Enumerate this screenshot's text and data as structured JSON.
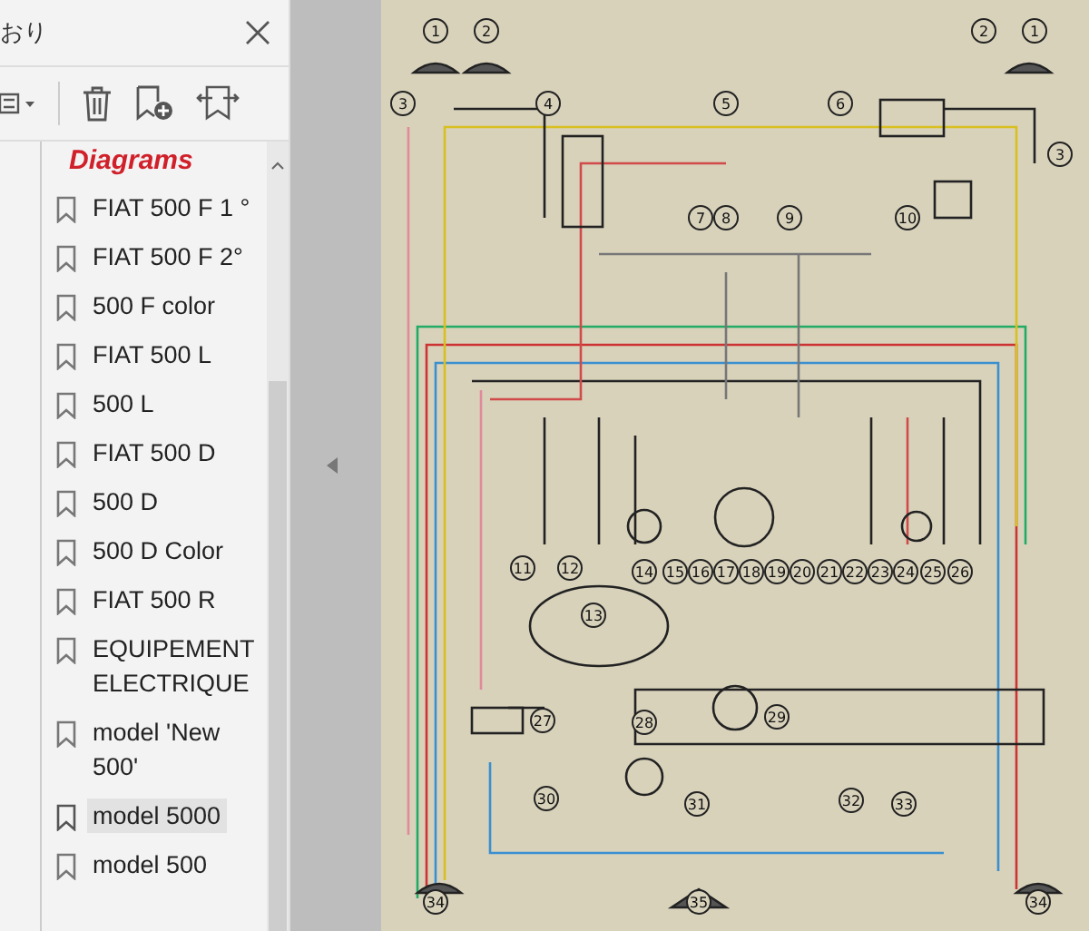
{
  "panel": {
    "title": "おり"
  },
  "bookmarks": {
    "heading": "Diagrams",
    "items": [
      {
        "label": "FIAT 500 F 1 °",
        "selected": false
      },
      {
        "label": "FIAT 500 F 2°",
        "selected": false
      },
      {
        "label": "500 F color",
        "selected": false
      },
      {
        "label": "FIAT 500 L",
        "selected": false
      },
      {
        "label": "500 L",
        "selected": false
      },
      {
        "label": "FIAT 500 D",
        "selected": false
      },
      {
        "label": "500 D",
        "selected": false
      },
      {
        "label": "500 D Color",
        "selected": false
      },
      {
        "label": "FIAT 500 R",
        "selected": false
      },
      {
        "label": "EQUIPEMENT ELECTRIQUE",
        "selected": false
      },
      {
        "label": "model 'New 500'",
        "selected": false
      },
      {
        "label": "model 5000",
        "selected": true
      },
      {
        "label": "model 500",
        "selected": false
      }
    ]
  },
  "diagram": {
    "labels": [
      "1",
      "2",
      "3",
      "4",
      "5",
      "6",
      "7",
      "8",
      "9",
      "10",
      "11",
      "12",
      "13",
      "14",
      "15",
      "16",
      "17",
      "18",
      "19",
      "20",
      "21",
      "22",
      "23",
      "24",
      "25",
      "26",
      "27",
      "28",
      "29",
      "30",
      "31",
      "32",
      "33",
      "34",
      "35",
      "2",
      "1",
      "3",
      "34"
    ]
  }
}
